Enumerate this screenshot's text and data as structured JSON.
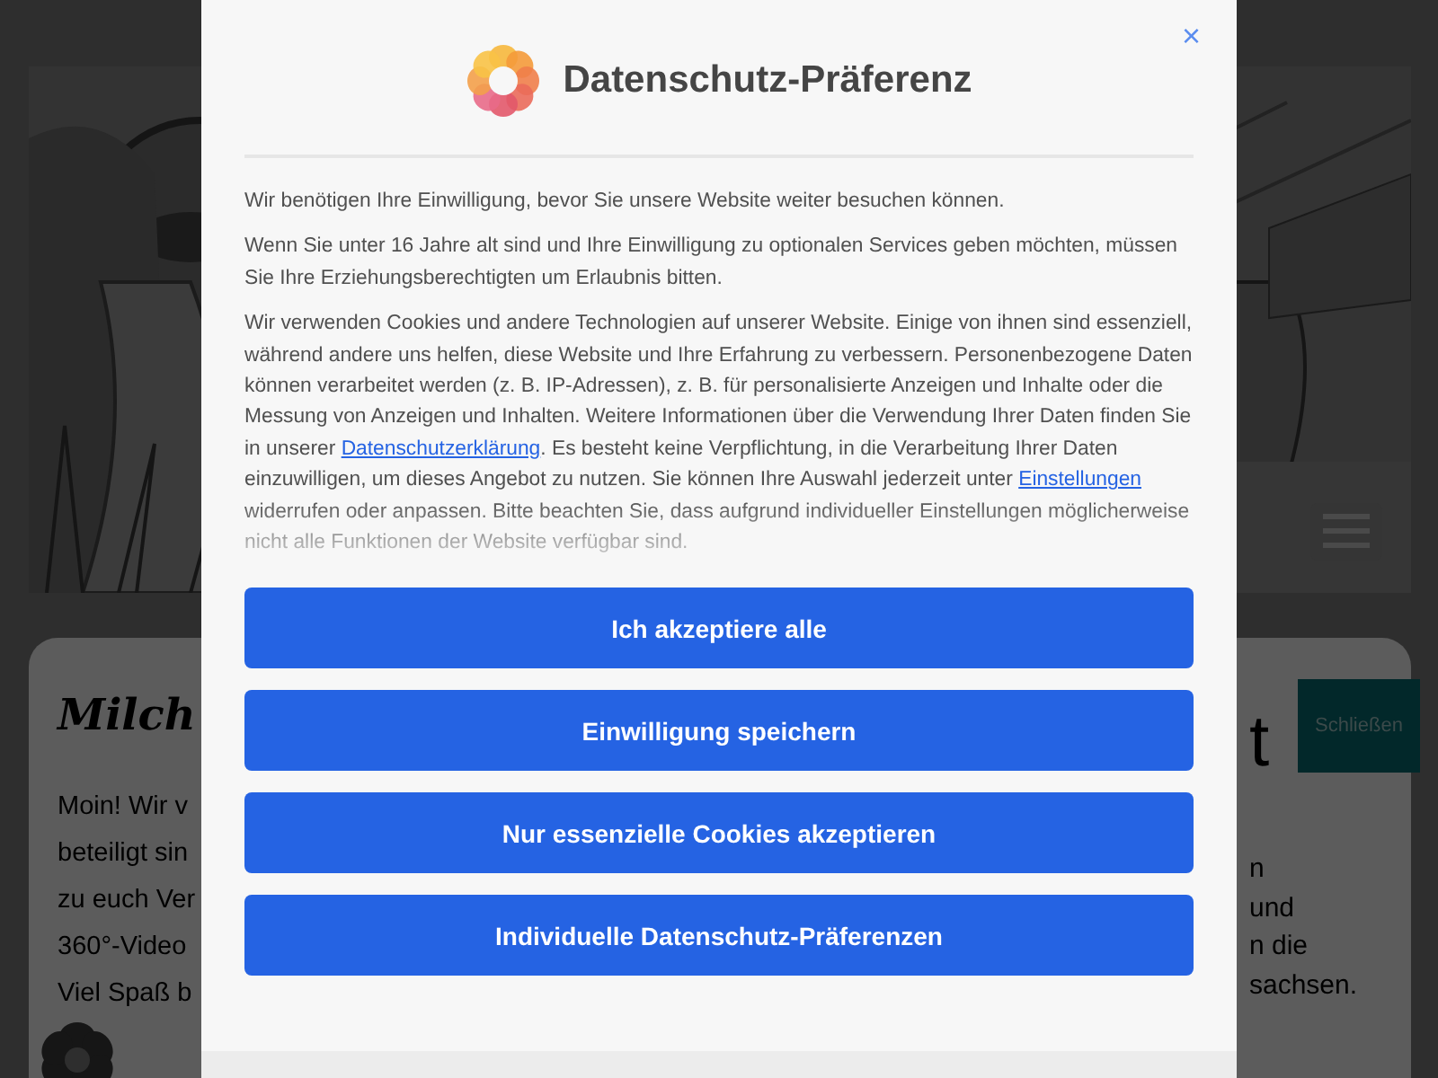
{
  "background_page": {
    "heading": "Milch",
    "intro_lines": [
      "Moin! Wir v",
      "beteiligt sin",
      "zu euch Ver",
      "360°-Video",
      "Viel Spaß b"
    ],
    "right_heading": "t",
    "right_lines": [
      "n",
      "und",
      "n die",
      "sachsen."
    ],
    "close_button": "Schließen"
  },
  "consent_dialog": {
    "title": "Datenschutz-Präferenz",
    "close": "×",
    "paragraphs": [
      {
        "parts": [
          {
            "kind": "text",
            "text": "Wir benötigen Ihre Einwilligung, bevor Sie unsere Website weiter besuchen können."
          }
        ]
      },
      {
        "parts": [
          {
            "kind": "text",
            "text": "Wenn Sie unter 16 Jahre alt sind und Ihre Einwilligung zu optionalen Services geben möchten, müssen Sie Ihre Erziehungsberechtigten um Erlaubnis bitten."
          }
        ]
      },
      {
        "parts": [
          {
            "kind": "text",
            "text": "Wir verwenden Cookies und andere Technologien auf unserer Website. Einige von ihnen sind essenziell, während andere uns helfen, diese Website und Ihre Erfahrung zu verbessern. Personenbezogene Daten können verarbeitet werden (z. B. IP-Adressen), z. B. für personalisierte Anzeigen und Inhalte oder die Messung von Anzeigen und Inhalten. Weitere Informationen über die Verwendung Ihrer Daten finden Sie in unserer "
          },
          {
            "kind": "link",
            "text": "Datenschutzerklärung"
          },
          {
            "kind": "text",
            "text": ". Es besteht keine Verpflichtung, in die Verarbeitung Ihrer Daten einzuwilligen, um dieses Angebot zu nutzen. Sie können Ihre Auswahl jederzeit unter "
          },
          {
            "kind": "link",
            "text": "Einstellungen"
          },
          {
            "kind": "text",
            "text": " widerrufen oder anpassen. Bitte beachten Sie, dass aufgrund individueller Einstellungen möglicherweise nicht alle Funktionen der Website verfügbar sind."
          }
        ]
      }
    ],
    "buttons": [
      "Ich akzeptiere alle",
      "Einwilligung speichern",
      "Nur essenzielle Cookies akzeptieren",
      "Individuelle Datenschutz-Präferenzen"
    ]
  }
}
